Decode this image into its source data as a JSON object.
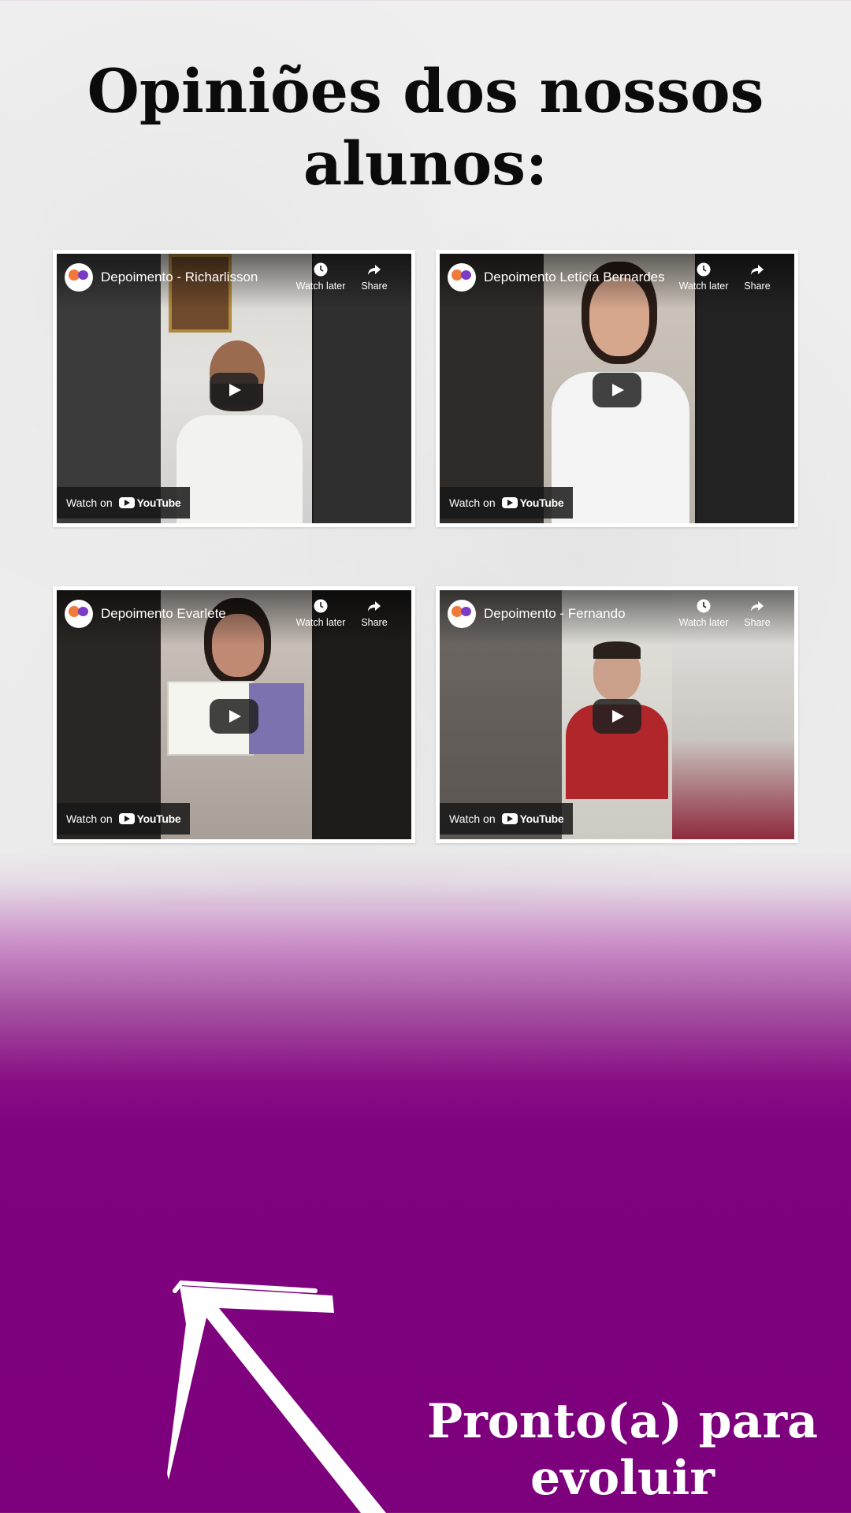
{
  "page": {
    "title": "Opiniões dos nossos alunos:",
    "cta": "Pronto(a) para evoluir conosco?"
  },
  "videos": [
    {
      "title": "Depoimento - Richarlisson",
      "watch_later": "Watch later",
      "share": "Share",
      "watch_on": "Watch on",
      "youtube": "YouTube"
    },
    {
      "title": "Depoimento Letícia Bernardes",
      "watch_later": "Watch later",
      "share": "Share",
      "watch_on": "Watch on",
      "youtube": "YouTube"
    },
    {
      "title": "Depoimento Evarlete",
      "watch_later": "Watch later",
      "share": "Share",
      "watch_on": "Watch on",
      "youtube": "YouTube"
    },
    {
      "title": "Depoimento - Fernando",
      "watch_later": "Watch later",
      "share": "Share",
      "watch_on": "Watch on",
      "youtube": "YouTube"
    }
  ],
  "colors": {
    "accent_purple": "#7d007c",
    "background_light": "#ececec"
  },
  "icons": [
    "clock-icon",
    "share-arrow-icon",
    "play-icon",
    "youtube-logo-icon",
    "hand-drawn-arrow-icon"
  ]
}
